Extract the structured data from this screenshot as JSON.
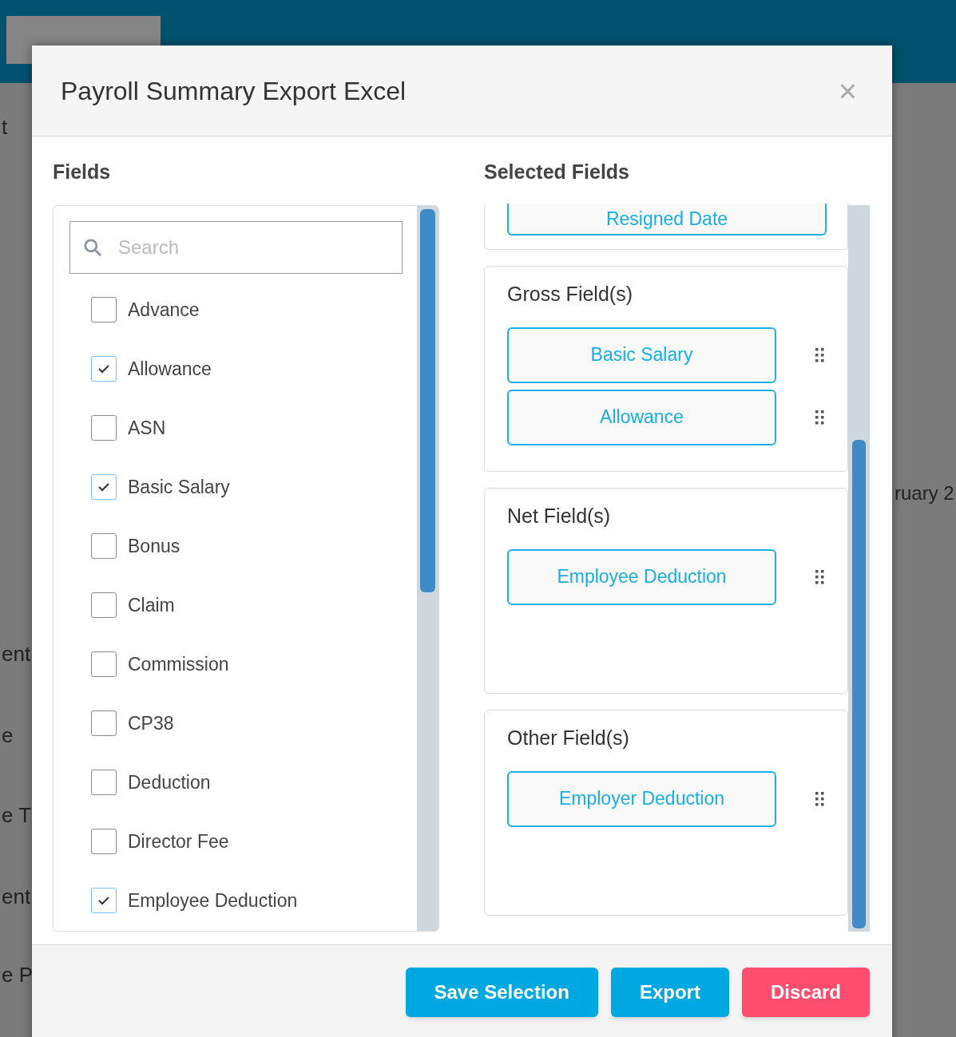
{
  "background": {
    "left_fragments": [
      "t",
      "ent",
      "e",
      "e T",
      "ent",
      "e P"
    ],
    "right_fragments": [
      "ruary 2"
    ]
  },
  "dialog": {
    "title": "Payroll Summary Export Excel",
    "close": "×"
  },
  "fields": {
    "heading": "Fields",
    "search": {
      "placeholder": "Search"
    },
    "items": [
      {
        "label": "Advance",
        "checked": false
      },
      {
        "label": "Allowance",
        "checked": true
      },
      {
        "label": "ASN",
        "checked": false
      },
      {
        "label": "Basic Salary",
        "checked": true
      },
      {
        "label": "Bonus",
        "checked": false
      },
      {
        "label": "Claim",
        "checked": false
      },
      {
        "label": "Commission",
        "checked": false
      },
      {
        "label": "CP38",
        "checked": false
      },
      {
        "label": "Deduction",
        "checked": false
      },
      {
        "label": "Director Fee",
        "checked": false
      },
      {
        "label": "Employee Deduction",
        "checked": true
      }
    ]
  },
  "selected_fields": {
    "heading": "Selected Fields",
    "sections": [
      {
        "chips": [
          {
            "label": "Resigned Date",
            "draggable": false
          }
        ]
      },
      {
        "title": "Gross Field(s)",
        "chips": [
          {
            "label": "Basic Salary",
            "draggable": true
          },
          {
            "label": "Allowance",
            "draggable": true
          }
        ]
      },
      {
        "title": "Net Field(s)",
        "chips": [
          {
            "label": "Employee Deduction",
            "draggable": true
          }
        ]
      },
      {
        "title": "Other Field(s)",
        "chips": [
          {
            "label": "Employer Deduction",
            "draggable": true
          }
        ]
      }
    ]
  },
  "buttons": [
    {
      "label": "Save Selection",
      "kind": "primary"
    },
    {
      "label": "Export",
      "kind": "primary"
    },
    {
      "label": "Discard",
      "kind": "danger"
    }
  ]
}
